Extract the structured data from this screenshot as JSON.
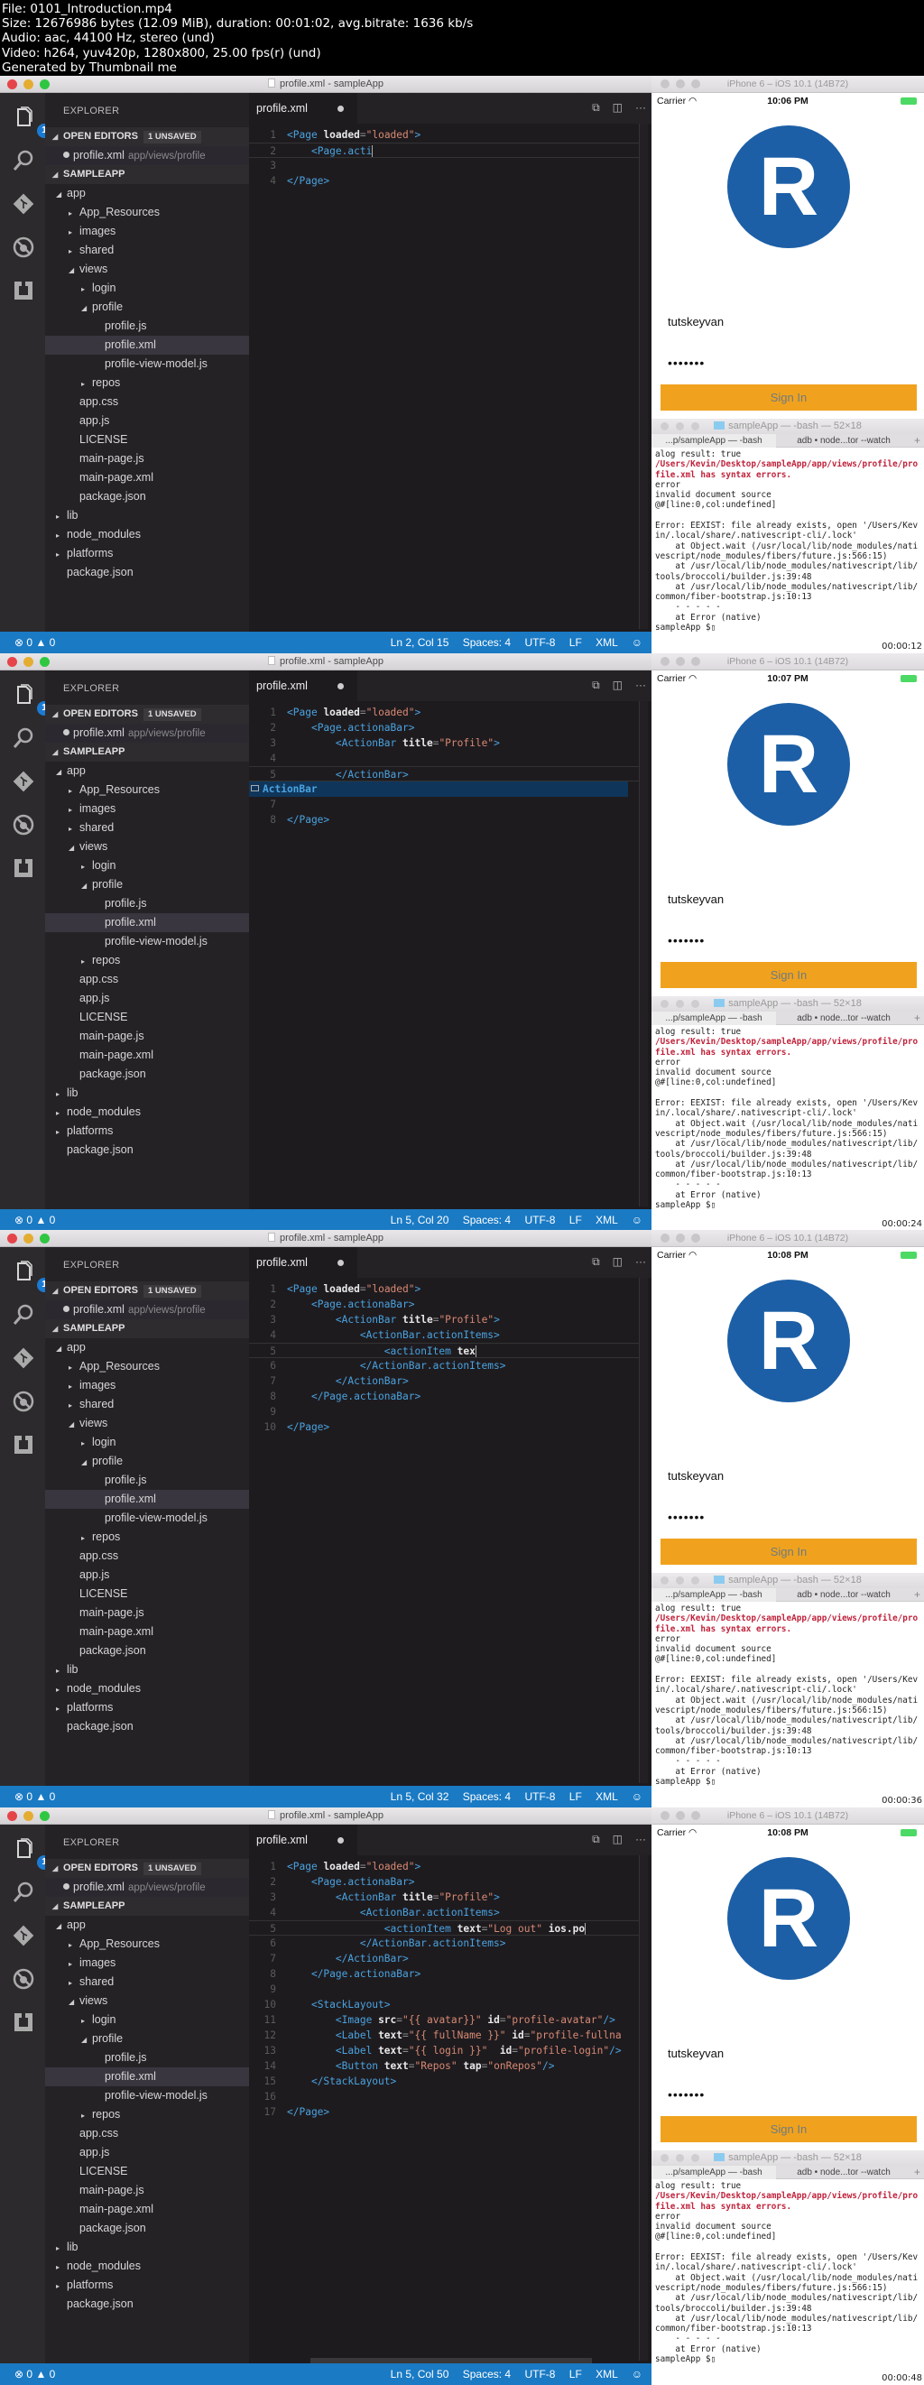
{
  "header": {
    "lines": [
      "File: 0101_Introduction.mp4",
      "Size: 12676986 bytes (12.09 MiB), duration: 00:01:02, avg.bitrate: 1636 kb/s",
      "Audio: aac, 44100 Hz, stereo (und)",
      "Video: h264, yuv420p, 1280x800, 25.00 fps(r) (und)",
      "Generated by Thumbnail me"
    ]
  },
  "common": {
    "window_title": "profile.xml - sampleApp",
    "explorer_title": "EXPLORER",
    "open_editors_label": "OPEN EDITORS",
    "unsaved_badge": "1 UNSAVED",
    "open_file_name": "profile.xml",
    "open_file_path": "app/views/profile",
    "project_label": "SAMPLEAPP",
    "activity_badge": "1",
    "tab_label": "profile.xml",
    "tree": [
      {
        "label": "app",
        "indent": 1,
        "twisty": "open"
      },
      {
        "label": "App_Resources",
        "indent": 2,
        "twisty": "closed"
      },
      {
        "label": "images",
        "indent": 2,
        "twisty": "closed"
      },
      {
        "label": "shared",
        "indent": 2,
        "twisty": "closed"
      },
      {
        "label": "views",
        "indent": 2,
        "twisty": "open"
      },
      {
        "label": "login",
        "indent": 3,
        "twisty": "closed"
      },
      {
        "label": "profile",
        "indent": 3,
        "twisty": "open"
      },
      {
        "label": "profile.js",
        "indent": 4,
        "twisty": "none"
      },
      {
        "label": "profile.xml",
        "indent": 4,
        "twisty": "none",
        "selected": true
      },
      {
        "label": "profile-view-model.js",
        "indent": 4,
        "twisty": "none"
      },
      {
        "label": "repos",
        "indent": 3,
        "twisty": "closed"
      },
      {
        "label": "app.css",
        "indent": 2,
        "twisty": "none"
      },
      {
        "label": "app.js",
        "indent": 2,
        "twisty": "none"
      },
      {
        "label": "LICENSE",
        "indent": 2,
        "twisty": "none"
      },
      {
        "label": "main-page.js",
        "indent": 2,
        "twisty": "none"
      },
      {
        "label": "main-page.xml",
        "indent": 2,
        "twisty": "none"
      },
      {
        "label": "package.json",
        "indent": 2,
        "twisty": "none"
      },
      {
        "label": "lib",
        "indent": 1,
        "twisty": "closed"
      },
      {
        "label": "node_modules",
        "indent": 1,
        "twisty": "closed"
      },
      {
        "label": "platforms",
        "indent": 1,
        "twisty": "closed"
      },
      {
        "label": "package.json",
        "indent": 1,
        "twisty": "none"
      }
    ],
    "status_errors": "0",
    "status_warnings": "0",
    "status_spaces": "Spaces: 4",
    "status_encoding": "UTF-8",
    "status_eol": "LF",
    "status_language": "XML",
    "sim_title": "iPhone 6 – iOS 10.1 (14B72)",
    "carrier": "Carrier",
    "avatar_letter": "R",
    "username": "tutskeyvan",
    "password_mask": "•••••••",
    "signin_label": "Sign In",
    "terminal_title": "sampleApp — -bash — 52×18",
    "terminal_tab1": "...p/sampleApp — -bash",
    "terminal_tab2": "adb • node...tor --watch",
    "terminal_lines": [
      {
        "text": "alog result: true",
        "style": "plain"
      },
      {
        "text": "/Users/Kevin/Desktop/sampleApp/app/views/profile/pro",
        "style": "red"
      },
      {
        "text": "file.xml has syntax errors.",
        "style": "red"
      },
      {
        "text": "error",
        "style": "green"
      },
      {
        "text": "invalid document source",
        "style": "green"
      },
      {
        "text": "@#[line:0,col:undefined]",
        "style": "green"
      },
      {
        "text": "",
        "style": "plain"
      },
      {
        "text": "Error: EEXIST: file already exists, open '/Users/Kev",
        "style": "plain"
      },
      {
        "text": "in/.local/share/.nativescript-cli/.lock'",
        "style": "plain"
      },
      {
        "text": "    at Object.wait (/usr/local/lib/node_modules/nati",
        "style": "plain"
      },
      {
        "text": "vescript/node_modules/fibers/future.js:566:15)",
        "style": "plain"
      },
      {
        "text": "    at /usr/local/lib/node_modules/nativescript/lib/",
        "style": "plain"
      },
      {
        "text": "tools/broccoli/builder.js:39:48",
        "style": "plain"
      },
      {
        "text": "    at /usr/local/lib/node_modules/nativescript/lib/",
        "style": "plain"
      },
      {
        "text": "common/fiber-bootstrap.js:10:13",
        "style": "plain"
      },
      {
        "text": "    - - - - -",
        "style": "plain"
      },
      {
        "text": "    at Error (native)",
        "style": "plain"
      },
      {
        "text": "sampleApp $▯",
        "style": "plain"
      }
    ]
  },
  "frames": [
    {
      "cursor_position": "Ln 2, Col 15",
      "ios_time": "10:06 PM",
      "timestamp": "00:00:12",
      "code_lines": [
        {
          "n": "1",
          "indent": 0,
          "tokens": [
            [
              "tag",
              "<Page"
            ],
            [
              "txt",
              " "
            ],
            [
              "attr",
              "loaded"
            ],
            [
              "pun",
              "="
            ],
            [
              "str",
              "\"loaded\""
            ],
            [
              "tag",
              ">"
            ]
          ]
        },
        {
          "n": "2",
          "indent": 1,
          "current": true,
          "tokens": [
            [
              "tag",
              "<Page.acti"
            ],
            [
              "pun",
              "|"
            ]
          ]
        },
        {
          "n": "3",
          "indent": 0,
          "tokens": []
        },
        {
          "n": "4",
          "indent": 0,
          "tokens": [
            [
              "tag",
              "</Page>"
            ]
          ]
        }
      ]
    },
    {
      "cursor_position": "Ln 5, Col 20",
      "ios_time": "10:07 PM",
      "timestamp": "00:00:24",
      "suggestion": "ActionBar",
      "code_lines": [
        {
          "n": "1",
          "indent": 0,
          "tokens": [
            [
              "tag",
              "<Page"
            ],
            [
              "txt",
              " "
            ],
            [
              "attr",
              "loaded"
            ],
            [
              "pun",
              "="
            ],
            [
              "str",
              "\"loaded\""
            ],
            [
              "tag",
              ">"
            ]
          ]
        },
        {
          "n": "2",
          "indent": 1,
          "tokens": [
            [
              "tag",
              "<Page.actionaBar>"
            ]
          ]
        },
        {
          "n": "3",
          "indent": 2,
          "tokens": [
            [
              "tag",
              "<ActionBar"
            ],
            [
              "txt",
              " "
            ],
            [
              "attr",
              "title"
            ],
            [
              "pun",
              "="
            ],
            [
              "str",
              "\"Profile\""
            ],
            [
              "tag",
              ">"
            ]
          ]
        },
        {
          "n": "4",
          "indent": 0,
          "tokens": []
        },
        {
          "n": "5",
          "indent": 2,
          "current": true,
          "tokens": [
            [
              "tag",
              "</ActionBar>"
            ]
          ]
        },
        {
          "n": "",
          "indent": 0,
          "suggest_row": true,
          "tokens": []
        },
        {
          "n": "7",
          "indent": 0,
          "tokens": []
        },
        {
          "n": "8",
          "indent": 0,
          "tokens": [
            [
              "tag",
              "</Page>"
            ]
          ]
        }
      ]
    },
    {
      "cursor_position": "Ln 5, Col 32",
      "ios_time": "10:08 PM",
      "timestamp": "00:00:36",
      "code_lines": [
        {
          "n": "1",
          "indent": 0,
          "tokens": [
            [
              "tag",
              "<Page"
            ],
            [
              "txt",
              " "
            ],
            [
              "attr",
              "loaded"
            ],
            [
              "pun",
              "="
            ],
            [
              "str",
              "\"loaded\""
            ],
            [
              "tag",
              ">"
            ]
          ]
        },
        {
          "n": "2",
          "indent": 1,
          "tokens": [
            [
              "tag",
              "<Page.actionaBar>"
            ]
          ]
        },
        {
          "n": "3",
          "indent": 2,
          "tokens": [
            [
              "tag",
              "<ActionBar"
            ],
            [
              "txt",
              " "
            ],
            [
              "attr",
              "title"
            ],
            [
              "pun",
              "="
            ],
            [
              "str",
              "\"Profile\""
            ],
            [
              "tag",
              ">"
            ]
          ]
        },
        {
          "n": "4",
          "indent": 3,
          "tokens": [
            [
              "tag",
              "<ActionBar.actionItems>"
            ]
          ]
        },
        {
          "n": "5",
          "indent": 4,
          "current": true,
          "tokens": [
            [
              "tag",
              "<actionItem"
            ],
            [
              "txt",
              " "
            ],
            [
              "attr",
              "tex"
            ],
            [
              "pun",
              "|"
            ]
          ]
        },
        {
          "n": "6",
          "indent": 3,
          "tokens": [
            [
              "tag",
              "</ActionBar.actionItems>"
            ]
          ]
        },
        {
          "n": "7",
          "indent": 2,
          "tokens": [
            [
              "tag",
              "</ActionBar>"
            ]
          ]
        },
        {
          "n": "8",
          "indent": 1,
          "tokens": [
            [
              "tag",
              "</Page.actionaBar>"
            ]
          ]
        },
        {
          "n": "9",
          "indent": 0,
          "tokens": []
        },
        {
          "n": "10",
          "indent": 0,
          "tokens": [
            [
              "tag",
              "</Page>"
            ]
          ]
        }
      ]
    },
    {
      "cursor_position": "Ln 5, Col 50",
      "ios_time": "10:08 PM",
      "timestamp": "00:00:48",
      "code_lines": [
        {
          "n": "1",
          "indent": 0,
          "tokens": [
            [
              "tag",
              "<Page"
            ],
            [
              "txt",
              " "
            ],
            [
              "attr",
              "loaded"
            ],
            [
              "pun",
              "="
            ],
            [
              "str",
              "\"loaded\""
            ],
            [
              "tag",
              ">"
            ]
          ]
        },
        {
          "n": "2",
          "indent": 1,
          "tokens": [
            [
              "tag",
              "<Page.actionaBar>"
            ]
          ]
        },
        {
          "n": "3",
          "indent": 2,
          "tokens": [
            [
              "tag",
              "<ActionBar"
            ],
            [
              "txt",
              " "
            ],
            [
              "attr",
              "title"
            ],
            [
              "pun",
              "="
            ],
            [
              "str",
              "\"Profile\""
            ],
            [
              "tag",
              ">"
            ]
          ]
        },
        {
          "n": "4",
          "indent": 3,
          "tokens": [
            [
              "tag",
              "<ActionBar.actionItems>"
            ]
          ]
        },
        {
          "n": "5",
          "indent": 4,
          "current": true,
          "tokens": [
            [
              "tag",
              "<actionItem"
            ],
            [
              "txt",
              " "
            ],
            [
              "attr",
              "text"
            ],
            [
              "pun",
              "="
            ],
            [
              "str",
              "\"Log out\""
            ],
            [
              "txt",
              " "
            ],
            [
              "attr",
              "ios.po"
            ],
            [
              "pun",
              "|"
            ]
          ]
        },
        {
          "n": "6",
          "indent": 3,
          "tokens": [
            [
              "tag",
              "</ActionBar.actionItems>"
            ]
          ]
        },
        {
          "n": "7",
          "indent": 2,
          "tokens": [
            [
              "tag",
              "</ActionBar>"
            ]
          ]
        },
        {
          "n": "8",
          "indent": 1,
          "tokens": [
            [
              "tag",
              "</Page.actionaBar>"
            ]
          ]
        },
        {
          "n": "9",
          "indent": 0,
          "tokens": []
        },
        {
          "n": "10",
          "indent": 1,
          "tokens": [
            [
              "tag",
              "<StackLayout>"
            ]
          ]
        },
        {
          "n": "11",
          "indent": 2,
          "tokens": [
            [
              "tag",
              "<Image"
            ],
            [
              "txt",
              " "
            ],
            [
              "attr",
              "src"
            ],
            [
              "pun",
              "="
            ],
            [
              "str",
              "\"{{ avatar}}\""
            ],
            [
              "txt",
              " "
            ],
            [
              "attr",
              "id"
            ],
            [
              "pun",
              "="
            ],
            [
              "str",
              "\"profile-avatar\""
            ],
            [
              "tag",
              "/>"
            ]
          ]
        },
        {
          "n": "12",
          "indent": 2,
          "tokens": [
            [
              "tag",
              "<Label"
            ],
            [
              "txt",
              " "
            ],
            [
              "attr",
              "text"
            ],
            [
              "pun",
              "="
            ],
            [
              "str",
              "\"{{ fullName }}\""
            ],
            [
              "txt",
              " "
            ],
            [
              "attr",
              "id"
            ],
            [
              "pun",
              "="
            ],
            [
              "str",
              "\"profile-fullna"
            ]
          ]
        },
        {
          "n": "13",
          "indent": 2,
          "tokens": [
            [
              "tag",
              "<Label"
            ],
            [
              "txt",
              " "
            ],
            [
              "attr",
              "text"
            ],
            [
              "pun",
              "="
            ],
            [
              "str",
              "\"{{ login }}\""
            ],
            [
              "txt",
              "  "
            ],
            [
              "attr",
              "id"
            ],
            [
              "pun",
              "="
            ],
            [
              "str",
              "\"profile-login\""
            ],
            [
              "tag",
              "/>"
            ]
          ]
        },
        {
          "n": "14",
          "indent": 2,
          "tokens": [
            [
              "tag",
              "<Button"
            ],
            [
              "txt",
              " "
            ],
            [
              "attr",
              "text"
            ],
            [
              "pun",
              "="
            ],
            [
              "str",
              "\"Repos\""
            ],
            [
              "txt",
              " "
            ],
            [
              "attr",
              "tap"
            ],
            [
              "pun",
              "="
            ],
            [
              "str",
              "\"onRepos\""
            ],
            [
              "tag",
              "/>"
            ]
          ]
        },
        {
          "n": "15",
          "indent": 1,
          "tokens": [
            [
              "tag",
              "</StackLayout>"
            ]
          ]
        },
        {
          "n": "16",
          "indent": 0,
          "tokens": []
        },
        {
          "n": "17",
          "indent": 0,
          "tokens": [
            [
              "tag",
              "</Page>"
            ]
          ]
        }
      ]
    }
  ]
}
